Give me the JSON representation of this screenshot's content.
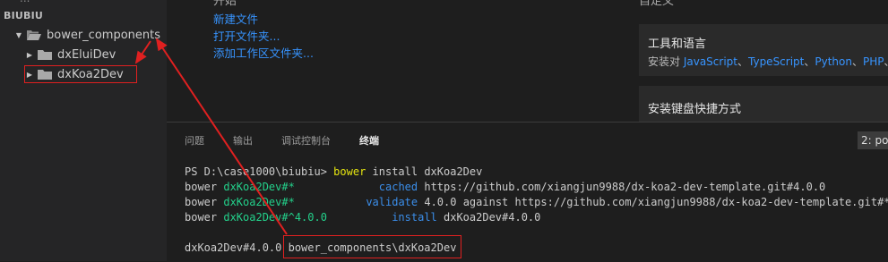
{
  "sidebar": {
    "cut_label": "...",
    "section_title": "BIUBIU",
    "tree": [
      {
        "label": "bower_components",
        "arrow": "▼",
        "open": true
      },
      {
        "label": "dxEluiDev",
        "arrow": "▶"
      },
      {
        "label": "dxKoa2Dev",
        "arrow": "▶",
        "highlighted": true
      }
    ]
  },
  "welcome": {
    "cut_heading_left": "开始",
    "cut_heading_right": "自定义",
    "links": [
      "新建文件",
      "打开文件夹...",
      "添加工作区文件夹..."
    ],
    "cards": [
      {
        "title": "工具和语言",
        "desc_prefix": "安装对 ",
        "desc_items": [
          "JavaScript",
          "TypeScript",
          "Python",
          "PHP"
        ],
        "desc_sep": "、",
        "desc_suffix": "、"
      },
      {
        "title": "安装键盘快捷方式"
      }
    ]
  },
  "panel": {
    "tabs": [
      "问题",
      "输出",
      "调试控制台",
      "终端"
    ],
    "active_tab": "终端",
    "terminal_select": "2: po",
    "terminal": {
      "prompt": "PS D:\\case1000\\biubiu> ",
      "command": "bower",
      "args": " install dxKoa2Dev",
      "lines": [
        {
          "a": "bower ",
          "pkg": "dxKoa2Dev#*",
          "pad": "             ",
          "action": "cached",
          "rest": " https://github.com/xiangjun9988/dx-koa2-dev-template.git#4.0.0"
        },
        {
          "a": "bower ",
          "pkg": "dxKoa2Dev#*",
          "pad": "           ",
          "action": "validate",
          "rest": " 4.0.0 against https://github.com/xiangjun9988/dx-koa2-dev-template.git#*"
        },
        {
          "a": "bower ",
          "pkg": "dxKoa2Dev#^4.0.0",
          "pad": "          ",
          "action": "install",
          "rest": " dxKoa2Dev#4.0.0"
        }
      ],
      "result_prefix": "dxKoa2Dev#4.0.0 ",
      "result_path": "bower_components\\dxKoa2Dev"
    }
  },
  "colors": {
    "annotation": "#e02020",
    "link": "#3794ff",
    "term_green": "#23d18b",
    "term_cyan": "#3b8eea",
    "term_yellow": "#e5e510"
  }
}
